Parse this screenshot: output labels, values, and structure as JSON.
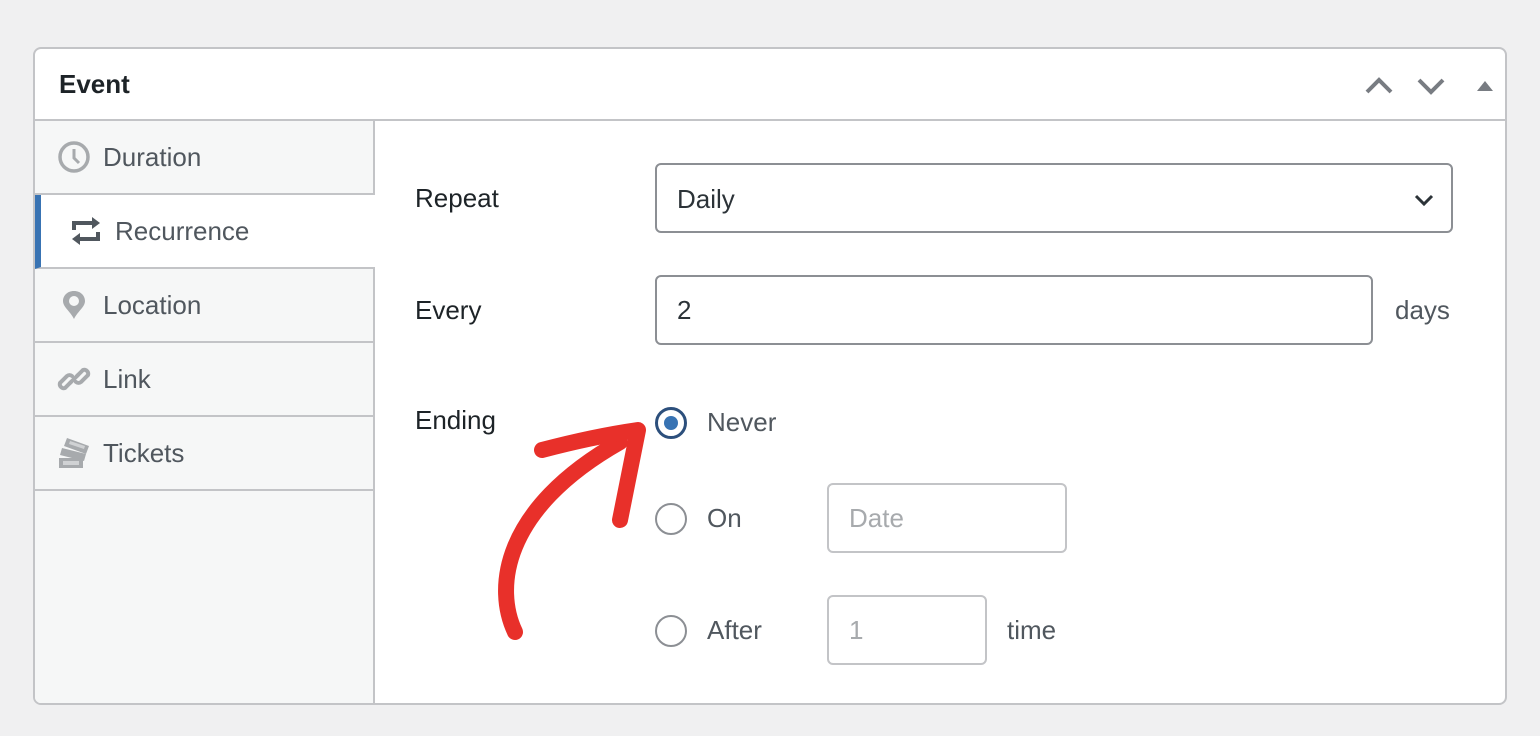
{
  "panel": {
    "title": "Event",
    "header_buttons": [
      {
        "name": "move-up",
        "icon": "chevron-up-icon"
      },
      {
        "name": "move-down",
        "icon": "chevron-down-icon"
      },
      {
        "name": "toggle-panel",
        "icon": "triangle-up-icon"
      }
    ]
  },
  "sidebar": {
    "tabs": [
      {
        "label": "Duration",
        "icon": "clock-icon",
        "active": false
      },
      {
        "label": "Recurrence",
        "icon": "repeat-icon",
        "active": true
      },
      {
        "label": "Location",
        "icon": "location-pin-icon",
        "active": false
      },
      {
        "label": "Link",
        "icon": "link-icon",
        "active": false
      },
      {
        "label": "Tickets",
        "icon": "tickets-icon",
        "active": false
      }
    ]
  },
  "recurrence": {
    "repeat": {
      "label": "Repeat",
      "selected": "Daily"
    },
    "every": {
      "label": "Every",
      "value": "2",
      "suffix": "days"
    },
    "ending": {
      "label": "Ending",
      "options": [
        {
          "label": "Never",
          "checked": true
        },
        {
          "label": "On",
          "checked": false,
          "input_placeholder": "Date",
          "input_value": ""
        },
        {
          "label": "After",
          "checked": false,
          "input_placeholder": "1",
          "input_value": "",
          "suffix": "time"
        }
      ]
    }
  },
  "annotation": {
    "type": "arrow",
    "color": "#e8302a",
    "points_to": "Never"
  },
  "colors": {
    "accent": "#3873b3",
    "border": "#c3c4c7",
    "sidebar_bg": "#f6f7f7",
    "page_bg": "#f0f0f1"
  }
}
